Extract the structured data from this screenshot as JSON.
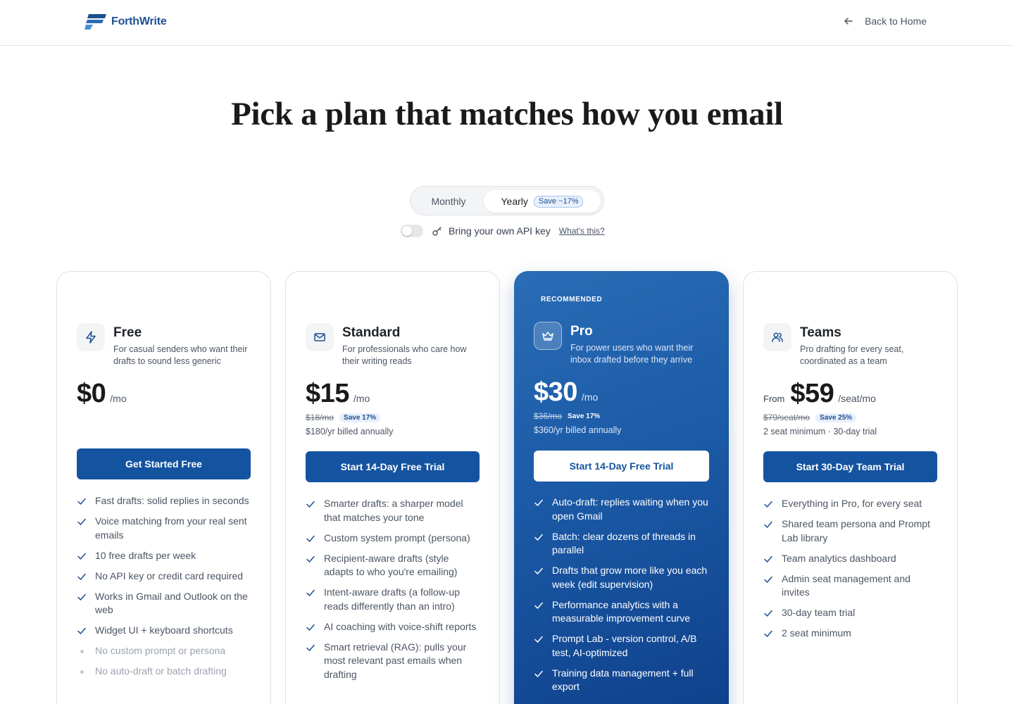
{
  "header": {
    "logo_text": "ForthWrite",
    "back_label": "Back to Home"
  },
  "hero": {
    "title": "Pick a plan that matches how you email"
  },
  "billing": {
    "monthly_label": "Monthly",
    "yearly_label": "Yearly",
    "yearly_save": "Save ~17%",
    "selected": "Yearly"
  },
  "api_key": {
    "label": "Bring your own API key",
    "help_link": "What's this?",
    "enabled": false
  },
  "colors": {
    "brand": "#14539f",
    "pro_gradient_start": "#2a6cb5",
    "pro_gradient_end": "#0f3f8a"
  },
  "plans": [
    {
      "name": "Free",
      "icon": "lightning-icon",
      "description": "For casual senders who want their drafts to sound less generic",
      "price_prefix": "",
      "price": "$0",
      "per": "/mo",
      "original_price": "",
      "save": "",
      "billed": "",
      "cta": "Get Started Free",
      "features": [
        "Fast drafts: solid replies in seconds",
        "Voice matching from your real sent emails",
        "10 free drafts per week",
        "No API key or credit card required",
        "Works in Gmail and Outlook on the web",
        "Widget UI + keyboard shortcuts"
      ],
      "excluded": [
        "No custom prompt or persona",
        "No auto-draft or batch drafting"
      ]
    },
    {
      "name": "Standard",
      "icon": "mail-icon",
      "description": "For professionals who care how their writing reads",
      "price_prefix": "",
      "price": "$15",
      "per": "/mo",
      "original_price": "$18/mo",
      "save": "Save 17%",
      "billed": "$180/yr billed annually",
      "cta": "Start 14-Day Free Trial",
      "features": [
        "Smarter drafts: a sharper model that matches your tone",
        "Custom system prompt (persona)",
        "Recipient-aware drafts (style adapts to who you're emailing)",
        "Intent-aware drafts (a follow-up reads differently than an intro)",
        "AI coaching with voice-shift reports",
        "Smart retrieval (RAG): pulls your most relevant past emails when drafting"
      ]
    },
    {
      "name": "Pro",
      "icon": "crown-icon",
      "badge": "RECOMMENDED",
      "description": "For power users who want their inbox drafted before they arrive",
      "price_prefix": "",
      "price": "$30",
      "per": "/mo",
      "original_price": "$36/mo",
      "save": "Save 17%",
      "billed": "$360/yr billed annually",
      "cta": "Start 14-Day Free Trial",
      "features": [
        "Auto-draft: replies waiting when you open Gmail",
        "Batch: clear dozens of threads in parallel",
        "Drafts that grow more like you each week (edit supervision)",
        "Performance analytics with a measurable improvement curve",
        "Prompt Lab - version control, A/B test, AI-optimized",
        "Training data management + full export"
      ]
    },
    {
      "name": "Teams",
      "icon": "users-icon",
      "description": "Pro drafting for every seat, coordinated as a team",
      "price_prefix": "From",
      "price": "$59",
      "per": "/seat/mo",
      "original_price": "$79/seat/mo",
      "save": "Save 25%",
      "billed": "2 seat minimum · 30-day trial",
      "cta": "Start 30-Day Team Trial",
      "features": [
        "Everything in Pro, for every seat",
        "Shared team persona and Prompt Lab library",
        "Team analytics dashboard",
        "Admin seat management and invites",
        "30-day team trial",
        "2 seat minimum"
      ]
    }
  ]
}
